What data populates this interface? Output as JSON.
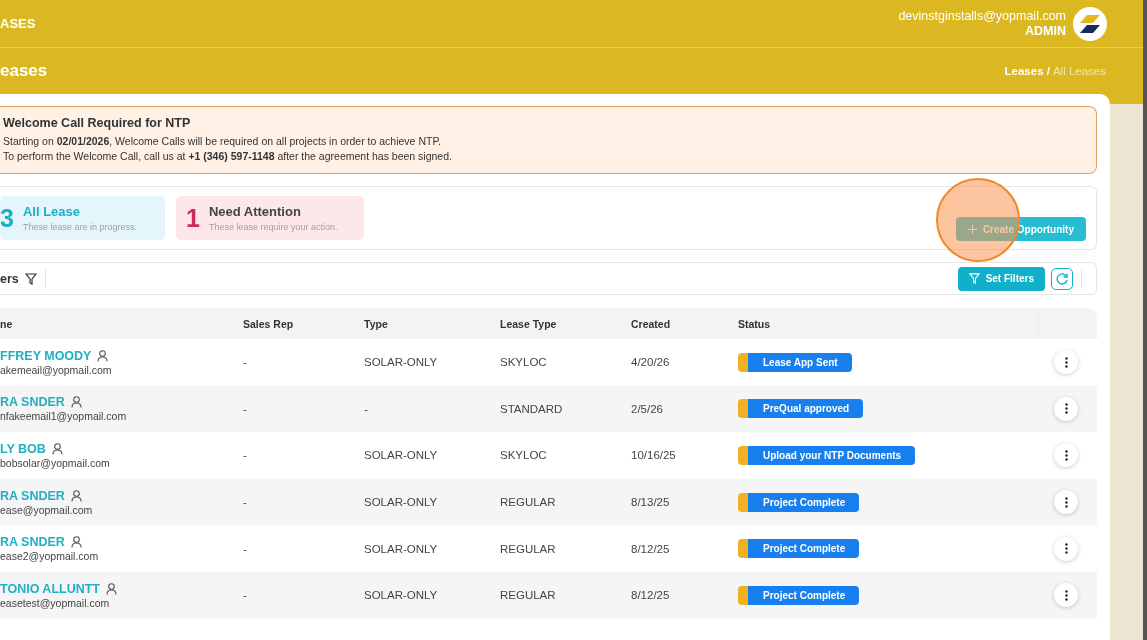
{
  "header": {
    "title": "ASES",
    "user_email": "devinstginstalls@yopmail.com",
    "user_role": "ADMIN"
  },
  "page": {
    "title": "eases",
    "breadcrumb": [
      {
        "label": "Leases /",
        "current": false
      },
      {
        "label": "All Leases",
        "current": true
      }
    ]
  },
  "notice": {
    "title": "Welcome Call Required for NTP",
    "lines": [
      "Starting on **02/01/2026**, Welcome Calls will be required on all projects in order to achieve NTP.",
      "To perform the Welcome Call, call us at **+1 (346) 597-1148** after the agreement has been signed."
    ]
  },
  "stats": [
    {
      "count": "3",
      "label": "All Lease",
      "description": "These lease are in progress.",
      "color": "#1fb0c4"
    },
    {
      "count": "1",
      "label": "Need Attention",
      "description": "These lease require your action.",
      "color": "#d02a5c"
    }
  ],
  "create_button": "Create Opportunity",
  "filters": {
    "label": "ers",
    "set_filters": "Set Filters"
  },
  "table": {
    "columns": [
      "ne",
      "Sales Rep",
      "Type",
      "Lease Type",
      "Created",
      "Status"
    ],
    "rows": [
      {
        "name": "FFREY MOODY",
        "email": "akemeail@yopmail.com",
        "sales_rep": "-",
        "type": "SOLAR-ONLY",
        "lease_type": "SKYLOC",
        "created": "4/20/26",
        "status": "Lease App Sent"
      },
      {
        "name": "RA SNDER",
        "email": "nfakeemail1@yopmail.com",
        "sales_rep": "-",
        "type": "-",
        "lease_type": "STANDARD",
        "created": "2/5/26",
        "status": "PreQual approved"
      },
      {
        "name": "LY BOB",
        "email": "bobsolar@yopmail.com",
        "sales_rep": "-",
        "type": "SOLAR-ONLY",
        "lease_type": "SKYLOC",
        "created": "10/16/25",
        "status": "Upload your NTP Documents"
      },
      {
        "name": "RA SNDER",
        "email": "ease@yopmail.com",
        "sales_rep": "-",
        "type": "SOLAR-ONLY",
        "lease_type": "REGULAR",
        "created": "8/13/25",
        "status": "Project Complete"
      },
      {
        "name": "RA SNDER",
        "email": "ease2@yopmail.com",
        "sales_rep": "-",
        "type": "SOLAR-ONLY",
        "lease_type": "REGULAR",
        "created": "8/12/25",
        "status": "Project Complete"
      },
      {
        "name": "TONIO ALLUNTT",
        "email": "easetest@yopmail.com",
        "sales_rep": "-",
        "type": "SOLAR-ONLY",
        "lease_type": "REGULAR",
        "created": "8/12/25",
        "status": "Project Complete"
      }
    ]
  }
}
